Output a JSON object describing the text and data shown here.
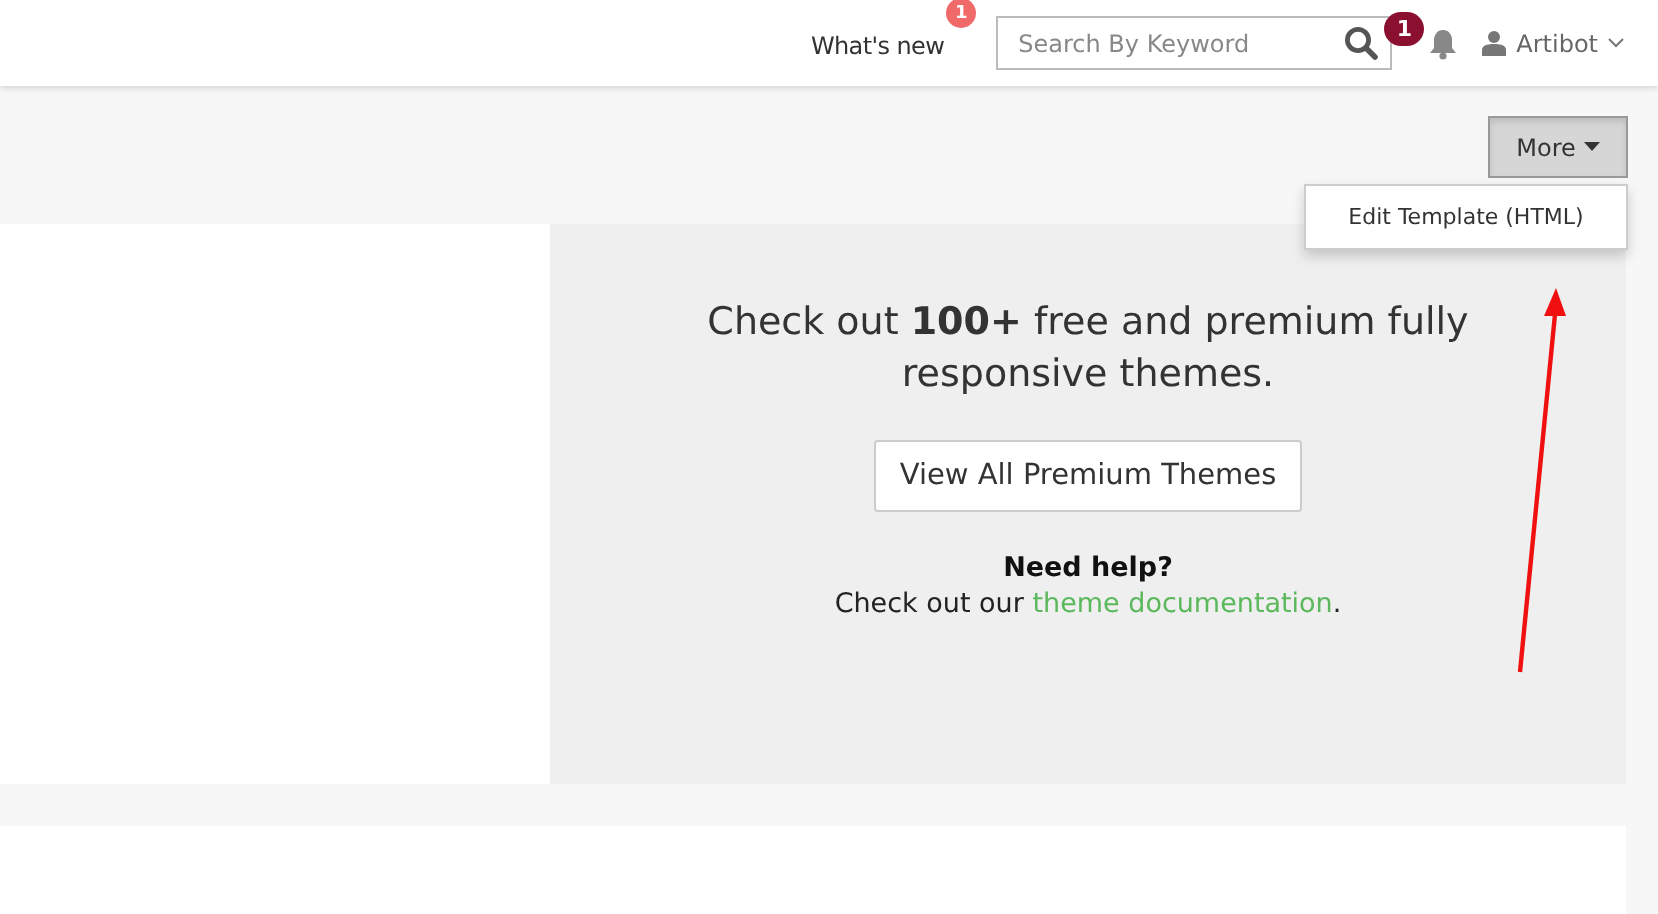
{
  "header": {
    "whats_new": {
      "label": "What's new",
      "badge": "1"
    },
    "search": {
      "placeholder": "Search By Keyword"
    },
    "notifications": {
      "badge": "1"
    },
    "user": {
      "name": "Artibot"
    }
  },
  "toolbar": {
    "more_button": {
      "label": "More",
      "open": true
    },
    "menu_items": [
      "Edit Template (HTML)"
    ]
  },
  "promo": {
    "headline": "Check out **100+** free and premium fully responsive themes.",
    "button": "View All Premium Themes",
    "help_title": "Need help?",
    "help_prefix": "Check out our ",
    "help_link": "theme documentation",
    "help_suffix": "."
  }
}
